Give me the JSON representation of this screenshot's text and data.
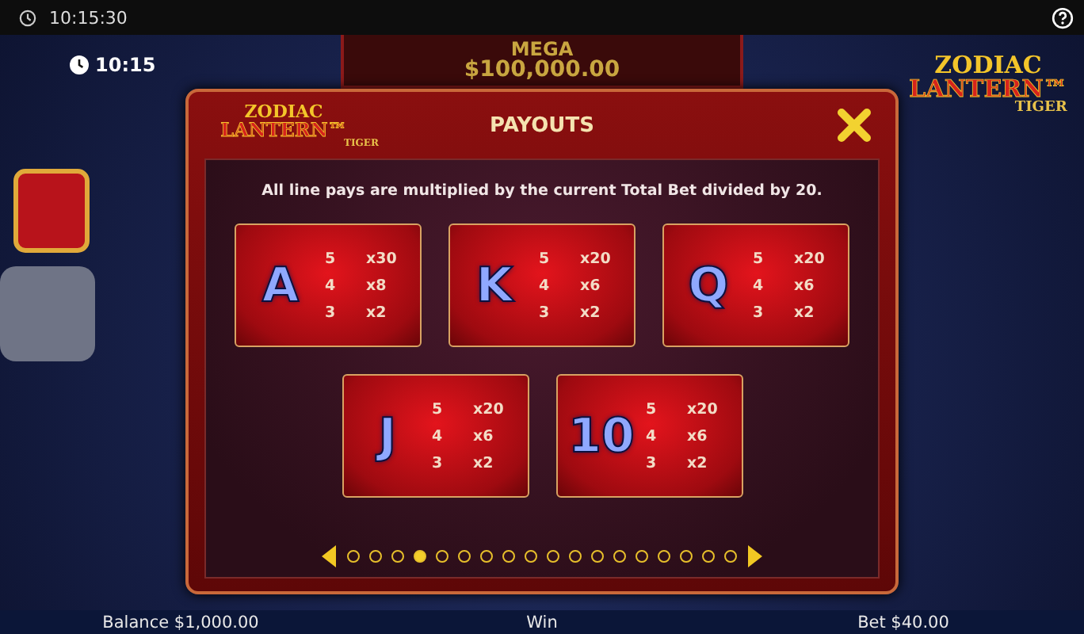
{
  "top_bar": {
    "time": "10:15:30"
  },
  "clock": "10:15",
  "jackpot": {
    "label": "MEGA",
    "amount": "$100,000.00"
  },
  "game_logo": {
    "line1": "ZODIAC",
    "line2": "LANTERN™",
    "line3": "TIGER"
  },
  "modal": {
    "logo": {
      "line1": "ZODIAC",
      "line2": "LANTERN™",
      "line3": "TIGER"
    },
    "title": "PAYOUTS",
    "note": "All line pays are multiplied by the current Total Bet divided by 20.",
    "symbols": [
      {
        "symbol": "A",
        "pays": [
          {
            "count": "5",
            "multiplier": "x30"
          },
          {
            "count": "4",
            "multiplier": "x8"
          },
          {
            "count": "3",
            "multiplier": "x2"
          }
        ]
      },
      {
        "symbol": "K",
        "pays": [
          {
            "count": "5",
            "multiplier": "x20"
          },
          {
            "count": "4",
            "multiplier": "x6"
          },
          {
            "count": "3",
            "multiplier": "x2"
          }
        ]
      },
      {
        "symbol": "Q",
        "pays": [
          {
            "count": "5",
            "multiplier": "x20"
          },
          {
            "count": "4",
            "multiplier": "x6"
          },
          {
            "count": "3",
            "multiplier": "x2"
          }
        ]
      },
      {
        "symbol": "J",
        "pays": [
          {
            "count": "5",
            "multiplier": "x20"
          },
          {
            "count": "4",
            "multiplier": "x6"
          },
          {
            "count": "3",
            "multiplier": "x2"
          }
        ]
      },
      {
        "symbol": "10",
        "pays": [
          {
            "count": "5",
            "multiplier": "x20"
          },
          {
            "count": "4",
            "multiplier": "x6"
          },
          {
            "count": "3",
            "multiplier": "x2"
          }
        ]
      }
    ],
    "pages": [
      {
        "selected": false
      },
      {
        "selected": false
      },
      {
        "selected": false
      },
      {
        "selected": true
      },
      {
        "selected": false
      },
      {
        "selected": false
      },
      {
        "selected": false
      },
      {
        "selected": false
      },
      {
        "selected": false
      },
      {
        "selected": false
      },
      {
        "selected": false
      },
      {
        "selected": false
      },
      {
        "selected": false
      },
      {
        "selected": false
      },
      {
        "selected": false
      },
      {
        "selected": false
      },
      {
        "selected": false
      },
      {
        "selected": false
      }
    ]
  },
  "bottom_bar": {
    "balance": "Balance $1,000.00",
    "win": "Win",
    "bet": "Bet $40.00"
  }
}
